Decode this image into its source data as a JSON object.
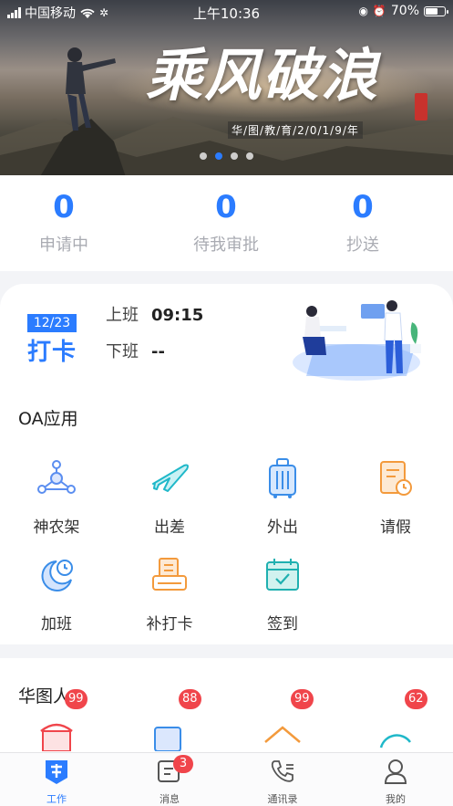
{
  "status_bar": {
    "carrier": "中国移动",
    "time": "上午10:36",
    "battery": "70%",
    "battery_level": 0.7
  },
  "banner": {
    "title": "乘风破浪",
    "subtitle": "华/图/教/育/2/0/1/9/年",
    "slide_count": 4,
    "active_slide": 1
  },
  "stats": [
    {
      "value": "0",
      "label": "申请中"
    },
    {
      "value": "0",
      "label": "待我审批"
    },
    {
      "value": "0",
      "label": "抄送"
    }
  ],
  "clock_in": {
    "date": "12/23",
    "label": "打卡",
    "on_label": "上班",
    "on_time": "09:15",
    "off_label": "下班",
    "off_time": "--"
  },
  "oa": {
    "title": "OA应用",
    "items": [
      {
        "label": "神农架",
        "icon": "network-icon"
      },
      {
        "label": "出差",
        "icon": "airplane-icon"
      },
      {
        "label": "外出",
        "icon": "luggage-icon"
      },
      {
        "label": "请假",
        "icon": "leave-form-icon"
      },
      {
        "label": "加班",
        "icon": "moon-clock-icon"
      },
      {
        "label": "补打卡",
        "icon": "punch-card-icon"
      },
      {
        "label": "签到",
        "icon": "calendar-check-icon"
      }
    ]
  },
  "people": {
    "title": "华图人",
    "badges": [
      "99",
      "88",
      "99",
      "62"
    ]
  },
  "tabbar": {
    "items": [
      {
        "label": "工作",
        "icon": "work-icon",
        "active": true
      },
      {
        "label": "消息",
        "icon": "message-icon",
        "badge": "3"
      },
      {
        "label": "通讯录",
        "icon": "contacts-icon"
      },
      {
        "label": "我的",
        "icon": "profile-icon"
      }
    ]
  },
  "colors": {
    "accent": "#2b7cff",
    "badge": "#f0454b",
    "orange": "#f39a3c",
    "teal": "#1fb8c9"
  }
}
